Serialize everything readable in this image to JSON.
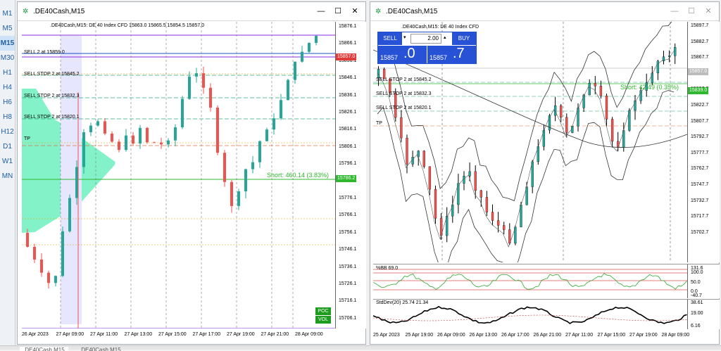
{
  "timeframes": {
    "items": [
      "M1",
      "M5",
      "M15",
      "M30",
      "H1",
      "H4",
      "H6",
      "H8",
      "H12",
      "D1",
      "W1",
      "MN"
    ],
    "active": 2
  },
  "left_chart": {
    "title": ".DE40Cash,M15",
    "info": ".DE40Cash,M15:  DE 40 Index CFD   15863.0 15865.5 15854.5 15857.0",
    "price_axis": [
      "15876.1",
      "15866.1",
      "15856.1",
      "15846.1",
      "15836.1",
      "15826.1",
      "15816.1",
      "15806.1",
      "15796.1",
      "15786.1",
      "15776.1",
      "15766.1",
      "15756.1",
      "15746.1",
      "15736.1",
      "15726.1",
      "15716.1",
      "15706.1"
    ],
    "current_price": "15857.0",
    "short_price": "15786.2",
    "time_axis": [
      "26 Apr 2023",
      "27 Apr 09:00",
      "27 Apr 11:00",
      "27 Apr 13:00",
      "27 Apr 15:00",
      "27 Apr 17:00",
      "27 Apr 19:00",
      "27 Apr 21:00",
      "28 Apr 09:00"
    ],
    "orders": [
      "SELL 2 at 15859.0",
      "SELL STOP 2 at 15845.2",
      "SELL STOP 2 at 15832.3",
      "SELL STOP 2 at 15820.1",
      "TP"
    ],
    "short_label": "Short: 460.14  (3.83%)",
    "poc_label": "POC",
    "vol_label": "VOL"
  },
  "right_chart": {
    "title": ".DE40Cash,M15",
    "info": ".DE40Cash,M15:  DE 40 Index CFD",
    "sell_label": "SELL",
    "buy_label": "BUY",
    "volume": "2.00",
    "sell_price_small": "15857",
    "sell_price_big": ".0",
    "buy_price_small": "15857",
    "buy_price_big": ".7",
    "price_axis": [
      "15897.7",
      "15882.7",
      "15867.7",
      "15852.7",
      "15837.7",
      "15822.7",
      "15807.7",
      "15792.7",
      "15777.7",
      "15762.7",
      "15747.7",
      "15732.7",
      "15717.7",
      "15702.7"
    ],
    "current_price": "15857.0",
    "short_price": "15839.0",
    "orders": [
      "SELL STOP 2 at 15845.2",
      "SELL STOP 2 at 15832.3",
      "SELL STOP 2 at 15820.1",
      "TP"
    ],
    "short_label": "Short: 42.49  (0.35%)",
    "bb_label": "%BB 69.0",
    "bb_axis": [
      "131.6",
      "100.0",
      "50.0",
      "0.0",
      "-40.7"
    ],
    "std_label": "StdDev(20) 25.74 21.34",
    "std_axis": [
      "38.61",
      "19.00",
      "6.16"
    ],
    "time_axis": [
      "25 Apr 2023",
      "25 Apr 19:00",
      "26 Apr 09:00",
      "26 Apr 13:00",
      "26 Apr 17:00",
      "26 Apr 21:00",
      "27 Apr 11:00",
      "27 Apr 15:00",
      "27 Apr 19:00",
      "28 Apr 09:00"
    ]
  },
  "bottom_tabs": [
    ".DE40Cash,M15",
    ".DE40Cash,M15"
  ],
  "colors": {
    "bull": "#26a69a",
    "bear": "#ef5350",
    "profile": "#6ff0c0",
    "profile_blue": "#e6e6ff",
    "green": "#1faa1f",
    "purple": "#8a2be2",
    "orange": "#e0a000",
    "blue": "#2752d6"
  }
}
